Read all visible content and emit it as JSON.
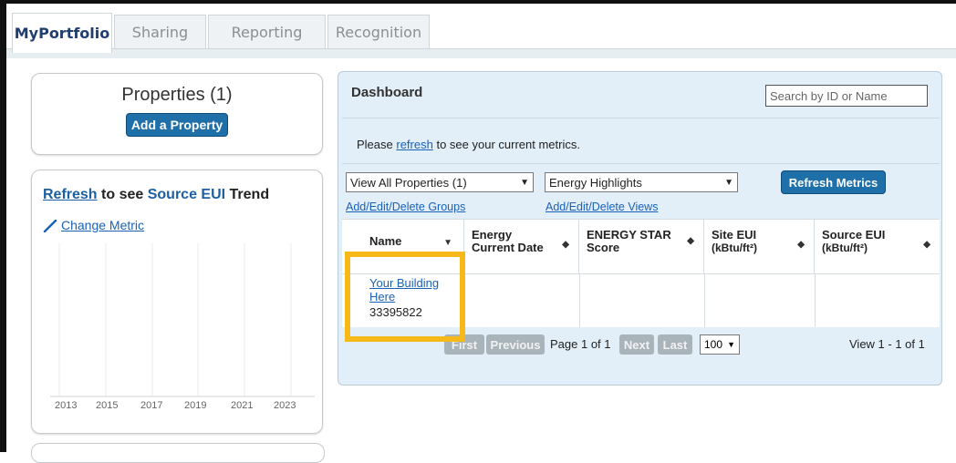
{
  "tabs": [
    {
      "label": "MyPortfolio",
      "active": true
    },
    {
      "label": "Sharing",
      "active": false
    },
    {
      "label": "Reporting",
      "active": false
    },
    {
      "label": "Recognition",
      "active": false
    }
  ],
  "properties": {
    "title": "Properties (1)",
    "add_button": "Add a Property"
  },
  "trend": {
    "refresh_link": "Refresh",
    "text_mid": " to see ",
    "metric_link": "Source EUI",
    "text_end": " Trend",
    "change_metric": "Change Metric",
    "years": [
      "2013",
      "2015",
      "2017",
      "2019",
      "2021",
      "2023"
    ]
  },
  "dashboard": {
    "title": "Dashboard",
    "search_placeholder": "Search by ID or Name",
    "notice_pre": "Please ",
    "notice_link": "refresh",
    "notice_post": " to see your current metrics.",
    "view_select": "View All Properties (1)",
    "highlight_select": "Energy Highlights",
    "refresh_button": "Refresh Metrics",
    "groups_link": "Add/Edit/Delete Groups",
    "views_link": "Add/Edit/Delete Views",
    "columns": [
      {
        "line1": "Name",
        "line2": ""
      },
      {
        "line1": "Energy",
        "line2": "Current Date"
      },
      {
        "line1": "ENERGY STAR",
        "line2": "Score"
      },
      {
        "line1": "Site EUI",
        "line2": "(kBtu/ft²)"
      },
      {
        "line1": "Source EUI",
        "line2": "(kBtu/ft²)"
      }
    ],
    "row": {
      "name_line1": "Your Building",
      "name_line2": "Here",
      "id": "33395822"
    },
    "pager": {
      "first": "First",
      "previous": "Previous",
      "page_text": "Page 1 of 1",
      "next": "Next",
      "last": "Last",
      "per_page": "100",
      "view_text": "View 1 - 1 of 1"
    }
  },
  "colors": {
    "highlight": "#f7b81a",
    "primary_button": "#1f6fa8",
    "link": "#1a62b8",
    "dashboard_bg": "#e2eef8"
  }
}
